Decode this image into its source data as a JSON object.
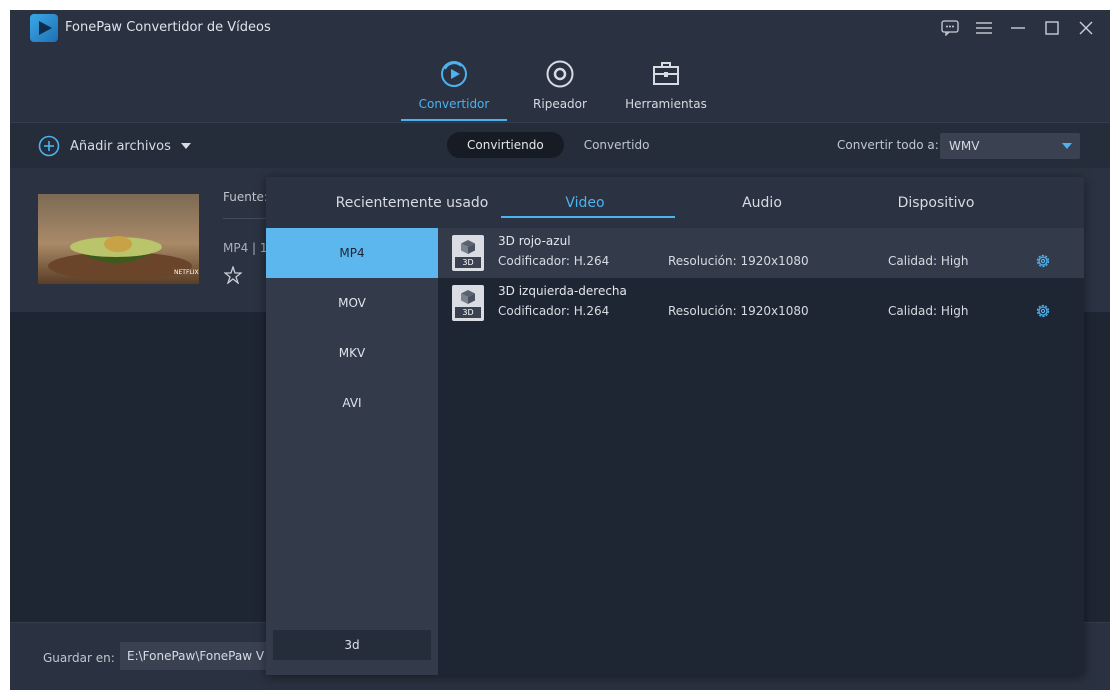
{
  "app": {
    "title": "FonePaw Convertidor de Vídeos"
  },
  "main_tabs": [
    {
      "label": "Convertidor",
      "icon": "convert-icon",
      "active": true
    },
    {
      "label": "Ripeador",
      "icon": "disc-icon",
      "active": false
    },
    {
      "label": "Herramientas",
      "icon": "toolbox-icon",
      "active": false
    }
  ],
  "toolbar": {
    "add_files_label": "Añadir archivos",
    "segments": [
      "Convirtiendo",
      "Convertido"
    ],
    "convert_all_label": "Convertir todo a:",
    "convert_all_value": "WMV"
  },
  "file": {
    "source_label": "Fuente:",
    "meta": "MP4 | 1",
    "thumbnail_badge": "NETFLIX"
  },
  "footer": {
    "save_label": "Guardar en:",
    "save_path": "E:\\FonePaw\\FonePaw V"
  },
  "format_panel": {
    "tabs": [
      "Recientemente usado",
      "Video",
      "Audio",
      "Dispositivo"
    ],
    "active_tab": 1,
    "formats": [
      "MP4",
      "MOV",
      "MKV",
      "AVI"
    ],
    "active_format": 0,
    "search_value": "3d",
    "presets": [
      {
        "icon_tag": "3D",
        "name": "3D rojo-azul",
        "encoder": "Codificador: H.264",
        "resolution": "Resolución: 1920x1080",
        "quality": "Calidad: High"
      },
      {
        "icon_tag": "3D",
        "name": "3D izquierda-derecha",
        "encoder": "Codificador: H.264",
        "resolution": "Resolución: 1920x1080",
        "quality": "Calidad: High"
      }
    ]
  },
  "colors": {
    "accent": "#4cb3f0",
    "background": "#1f2633",
    "panel": "#2b3241"
  }
}
